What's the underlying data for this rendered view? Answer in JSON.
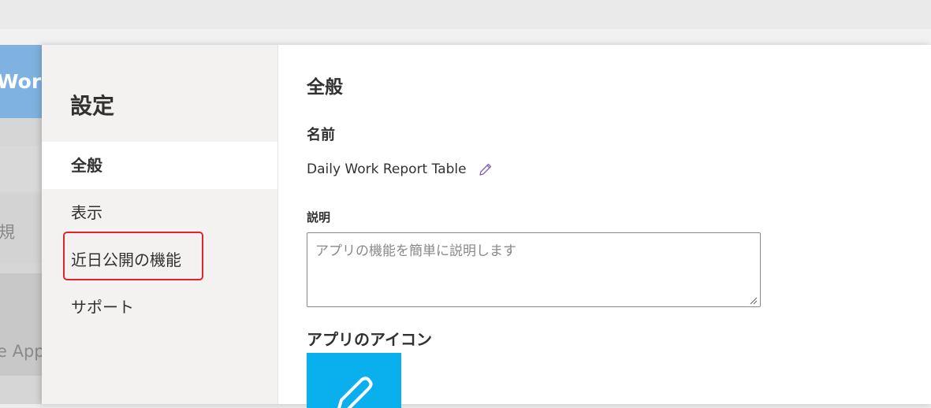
{
  "background_app": {
    "banner_text": "Work",
    "row1_text": "規",
    "row2_text": "e App"
  },
  "settings": {
    "title": "設定",
    "nav": [
      {
        "label": "全般",
        "active": true
      },
      {
        "label": "表示",
        "active": false
      },
      {
        "label": "近日公開の機能",
        "active": false,
        "highlighted": true
      },
      {
        "label": "サポート",
        "active": false
      }
    ]
  },
  "general": {
    "heading": "全般",
    "name_label": "名前",
    "name_value": "Daily Work Report Table",
    "edit_icon": "pencil-icon",
    "description_label": "説明",
    "description_value": "",
    "description_placeholder": "アプリの機能を簡単に説明します",
    "app_icon_label": "アプリのアイコン",
    "app_icon_color": "#0ab0ee",
    "app_icon_glyph": "pencil-icon"
  },
  "colors": {
    "accent": "#0ab0ee",
    "highlight_border": "#e0242c"
  }
}
